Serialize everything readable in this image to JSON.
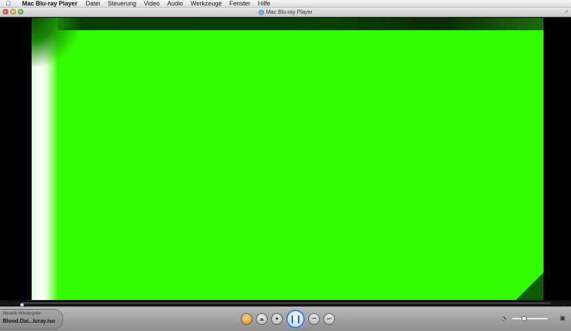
{
  "menubar": {
    "app_name": "Mac Blu-ray Player",
    "items": [
      "Datei",
      "Steuerung",
      "Video",
      "Audio",
      "Werkzeuge",
      "Fenster",
      "Hilfe"
    ]
  },
  "window": {
    "title": "Mac Blu-ray Player"
  },
  "playback": {
    "progress_fraction": 0.0,
    "time_elapsed": "--:--:--",
    "time_remaining": "--:--:--"
  },
  "now_playing": {
    "label": "Aktuelle Wiedergabe",
    "file": "Blood.Dai...luray.iso"
  },
  "controls": {
    "menu_icon": "home-icon",
    "buttons": [
      "menu-button",
      "eject-button",
      "stop-button",
      "pause-button",
      "previous-button",
      "next-button"
    ]
  },
  "volume": {
    "level_fraction": 0.35
  },
  "colors": {
    "video_green": "#33ff00",
    "accent_blue": "#3d7fc4"
  }
}
